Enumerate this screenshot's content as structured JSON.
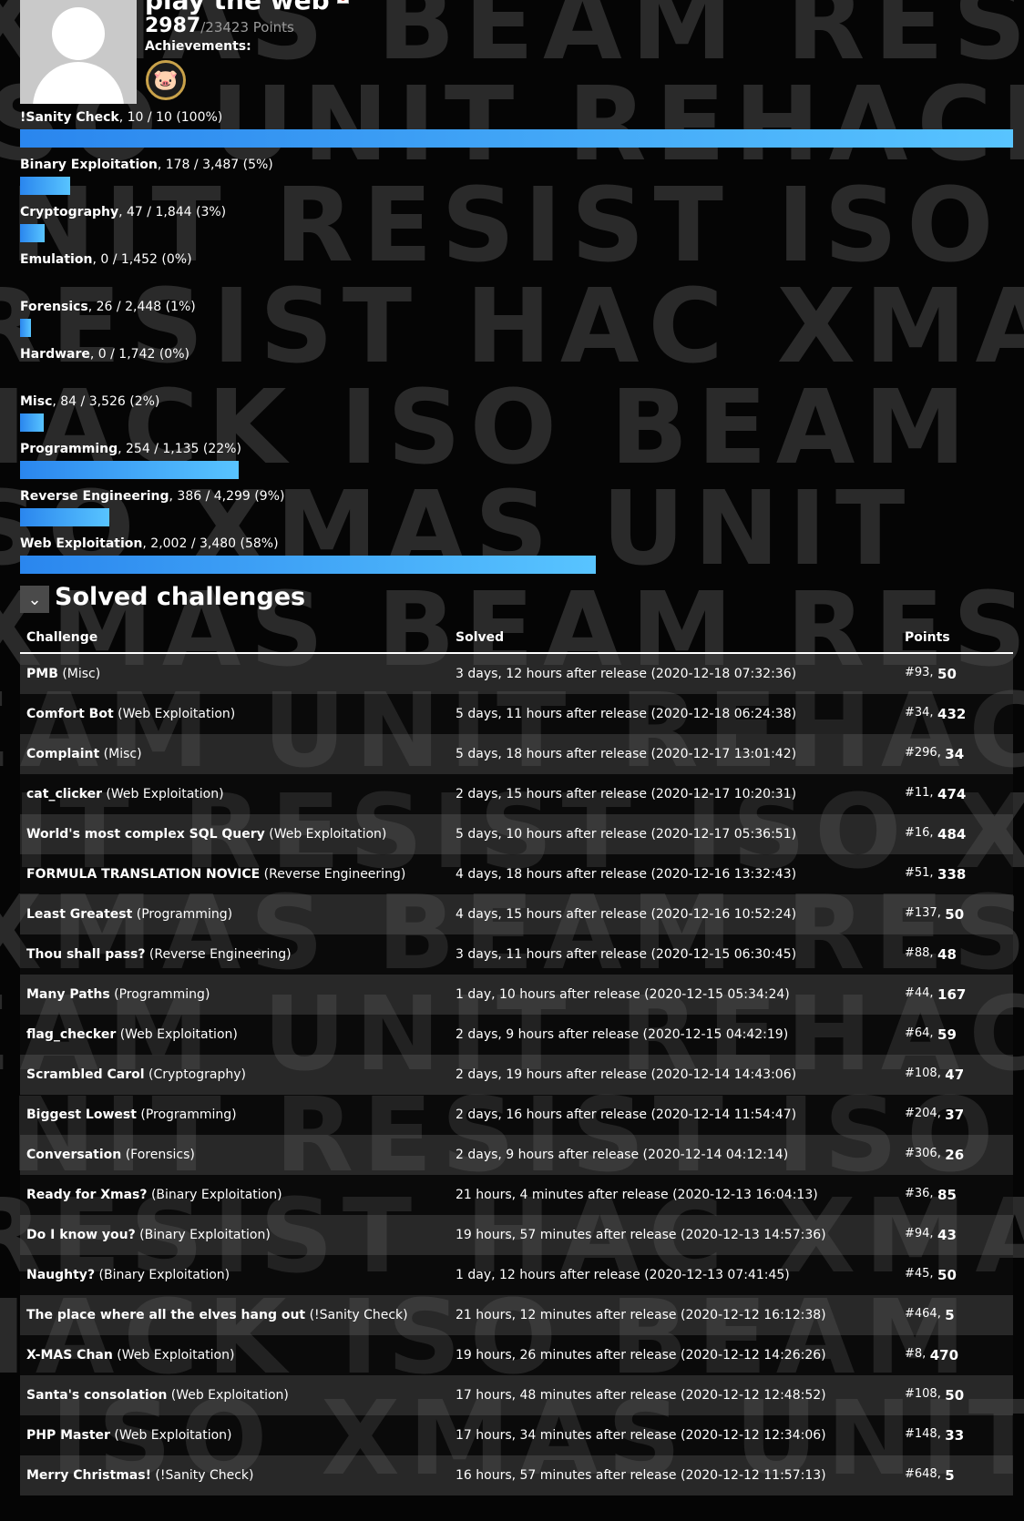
{
  "watermark": {
    "lines": [
      "XMAS BEAM RESIST",
      "ISO UNIT REHACK",
      "UNIT RESIST ISO X",
      "RESIST HAC XMAS",
      "HACK ISO BEAM",
      "ISO XMAS UNIT",
      "XMAS BEAM RESIS",
      "EAM UNIT REHACK",
      "NIT RESIST ISO X",
      "XMAS BEAM RESIS",
      "EAM UNIT REHACK",
      "UNIT RESIST ISO X",
      "RESIST HAC XMAS",
      "HACK ISO BEAM",
      "K ISO XMAS UNIT"
    ]
  },
  "profile": {
    "username": "play the web",
    "points": "2987",
    "points_total": "/23423 Points",
    "achievements_label": "Achievements:",
    "achievement_icon": "pig-badge-icon"
  },
  "categories": [
    {
      "name": "!Sanity Check",
      "stats": ", 10 / 10 (100%)",
      "fraction": 1.0
    },
    {
      "name": "Binary Exploitation",
      "stats": ", 178 / 3,487 (5%)",
      "fraction": 0.05
    },
    {
      "name": "Cryptography",
      "stats": ", 47 / 1,844 (3%)",
      "fraction": 0.025
    },
    {
      "name": "Emulation",
      "stats": ", 0 / 1,452 (0%)",
      "fraction": 0.0
    },
    {
      "name": "Forensics",
      "stats": ", 26 / 2,448 (1%)",
      "fraction": 0.011
    },
    {
      "name": "Hardware",
      "stats": ", 0 / 1,742 (0%)",
      "fraction": 0.0
    },
    {
      "name": "Misc",
      "stats": ", 84 / 3,526 (2%)",
      "fraction": 0.024
    },
    {
      "name": "Programming",
      "stats": ", 254 / 1,135 (22%)",
      "fraction": 0.22
    },
    {
      "name": "Reverse Engineering",
      "stats": ", 386 / 4,299 (9%)",
      "fraction": 0.09
    },
    {
      "name": "Web Exploitation",
      "stats": ", 2,002 / 3,480 (58%)",
      "fraction": 0.58
    }
  ],
  "solved": {
    "toggle_icon": "chevron-down-icon",
    "title": "Solved challenges",
    "columns": {
      "challenge": "Challenge",
      "solved": "Solved",
      "points": "Points"
    },
    "rows": [
      {
        "name": "PMB",
        "category": " (Misc)",
        "solved": "3 days, 12 hours after release (2020-12-18 07:32:36)",
        "rank": "#93,",
        "points": "50"
      },
      {
        "name": "Comfort Bot",
        "category": " (Web Exploitation)",
        "solved": "5 days, 11 hours after release (2020-12-18 06:24:38)",
        "rank": "#34,",
        "points": "432"
      },
      {
        "name": "Complaint",
        "category": " (Misc)",
        "solved": "5 days, 18 hours after release (2020-12-17 13:01:42)",
        "rank": "#296,",
        "points": "34"
      },
      {
        "name": "cat_clicker",
        "category": " (Web Exploitation)",
        "solved": "2 days, 15 hours after release (2020-12-17 10:20:31)",
        "rank": "#11,",
        "points": "474"
      },
      {
        "name": "World's most complex SQL Query",
        "category": " (Web Exploitation)",
        "solved": "5 days, 10 hours after release (2020-12-17 05:36:51)",
        "rank": "#16,",
        "points": "484"
      },
      {
        "name": "FORMULA TRANSLATION NOVICE",
        "category": " (Reverse Engineering)",
        "solved": "4 days, 18 hours after release (2020-12-16 13:32:43)",
        "rank": "#51,",
        "points": "338"
      },
      {
        "name": "Least Greatest",
        "category": " (Programming)",
        "solved": "4 days, 15 hours after release (2020-12-16 10:52:24)",
        "rank": "#137,",
        "points": "50"
      },
      {
        "name": "Thou shall pass?",
        "category": " (Reverse Engineering)",
        "solved": "3 days, 11 hours after release (2020-12-15 06:30:45)",
        "rank": "#88,",
        "points": "48"
      },
      {
        "name": "Many Paths",
        "category": " (Programming)",
        "solved": "1 day, 10 hours after release (2020-12-15 05:34:24)",
        "rank": "#44,",
        "points": "167"
      },
      {
        "name": "flag_checker",
        "category": " (Web Exploitation)",
        "solved": "2 days, 9 hours after release (2020-12-15 04:42:19)",
        "rank": "#64,",
        "points": "59"
      },
      {
        "name": "Scrambled Carol",
        "category": " (Cryptography)",
        "solved": "2 days, 19 hours after release (2020-12-14 14:43:06)",
        "rank": "#108,",
        "points": "47"
      },
      {
        "name": "Biggest Lowest",
        "category": " (Programming)",
        "solved": "2 days, 16 hours after release (2020-12-14 11:54:47)",
        "rank": "#204,",
        "points": "37"
      },
      {
        "name": "Conversation",
        "category": " (Forensics)",
        "solved": "2 days, 9 hours after release (2020-12-14 04:12:14)",
        "rank": "#306,",
        "points": "26"
      },
      {
        "name": "Ready for Xmas?",
        "category": " (Binary Exploitation)",
        "solved": "21 hours, 4 minutes after release (2020-12-13 16:04:13)",
        "rank": "#36,",
        "points": "85"
      },
      {
        "name": "Do I know you?",
        "category": " (Binary Exploitation)",
        "solved": "19 hours, 57 minutes after release (2020-12-13 14:57:36)",
        "rank": "#94,",
        "points": "43"
      },
      {
        "name": "Naughty?",
        "category": " (Binary Exploitation)",
        "solved": "1 day, 12 hours after release (2020-12-13 07:41:45)",
        "rank": "#45,",
        "points": "50"
      },
      {
        "name": "The place where all the elves hang out",
        "category": " (!Sanity Check)",
        "solved": "21 hours, 12 minutes after release (2020-12-12 16:12:38)",
        "rank": "#464,",
        "points": "5"
      },
      {
        "name": "X-MAS Chan",
        "category": " (Web Exploitation)",
        "solved": "19 hours, 26 minutes after release (2020-12-12 14:26:26)",
        "rank": "#8,",
        "points": "470"
      },
      {
        "name": "Santa's consolation",
        "category": " (Web Exploitation)",
        "solved": "17 hours, 48 minutes after release (2020-12-12 12:48:52)",
        "rank": "#108,",
        "points": "50"
      },
      {
        "name": "PHP Master",
        "category": " (Web Exploitation)",
        "solved": "17 hours, 34 minutes after release (2020-12-12 12:34:06)",
        "rank": "#148,",
        "points": "33"
      },
      {
        "name": "Merry Christmas!",
        "category": " (!Sanity Check)",
        "solved": "16 hours, 57 minutes after release (2020-12-12 11:57:13)",
        "rank": "#648,",
        "points": "5"
      }
    ]
  },
  "colors": {
    "background": "#050505",
    "bar_start": "#2a86ee",
    "bar_end": "#58c4ff",
    "watermark": "#2a2a2a",
    "row_alt": "#464646"
  }
}
